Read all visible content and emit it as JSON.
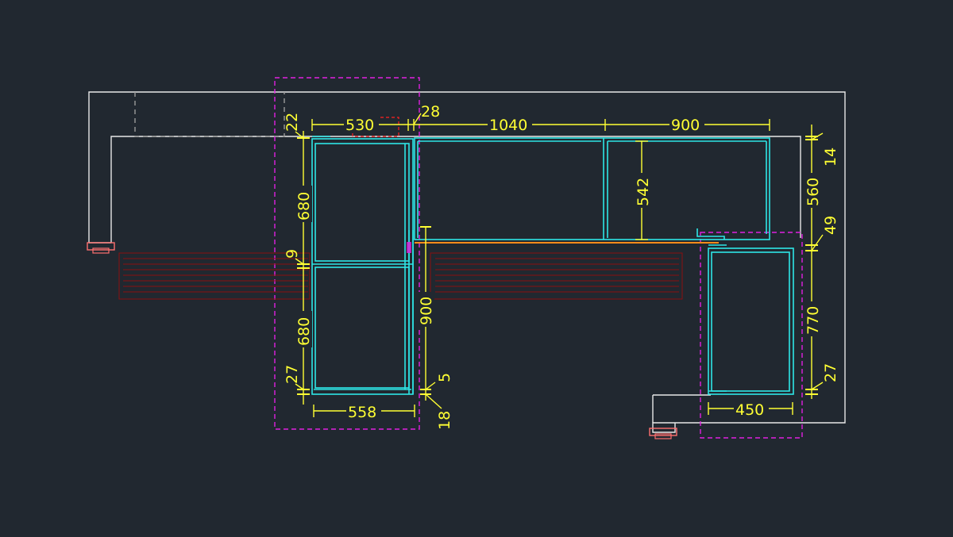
{
  "drawing": {
    "colors": {
      "background": "#212830",
      "cabinet": "#2ee6e6",
      "dimension": "#ffff33",
      "wall": "#e8e8e8",
      "boundary": "#e020e0",
      "hatch": "#8a1010",
      "fixture": "#ff7070",
      "counter_edge": "#ff8c1a"
    },
    "dimensions": {
      "d530": "530",
      "d28": "28",
      "d1040": "1040",
      "d900_top": "900",
      "d22": "22",
      "d680_upper": "680",
      "d9": "9",
      "d680_lower": "680",
      "d27_left": "27",
      "d558": "558",
      "d900_vertical": "900",
      "d5": "5",
      "d18": "18",
      "d542": "542",
      "d14": "14",
      "d560": "560",
      "d49": "49",
      "d770": "770",
      "d27_right": "27",
      "d450": "450"
    }
  }
}
